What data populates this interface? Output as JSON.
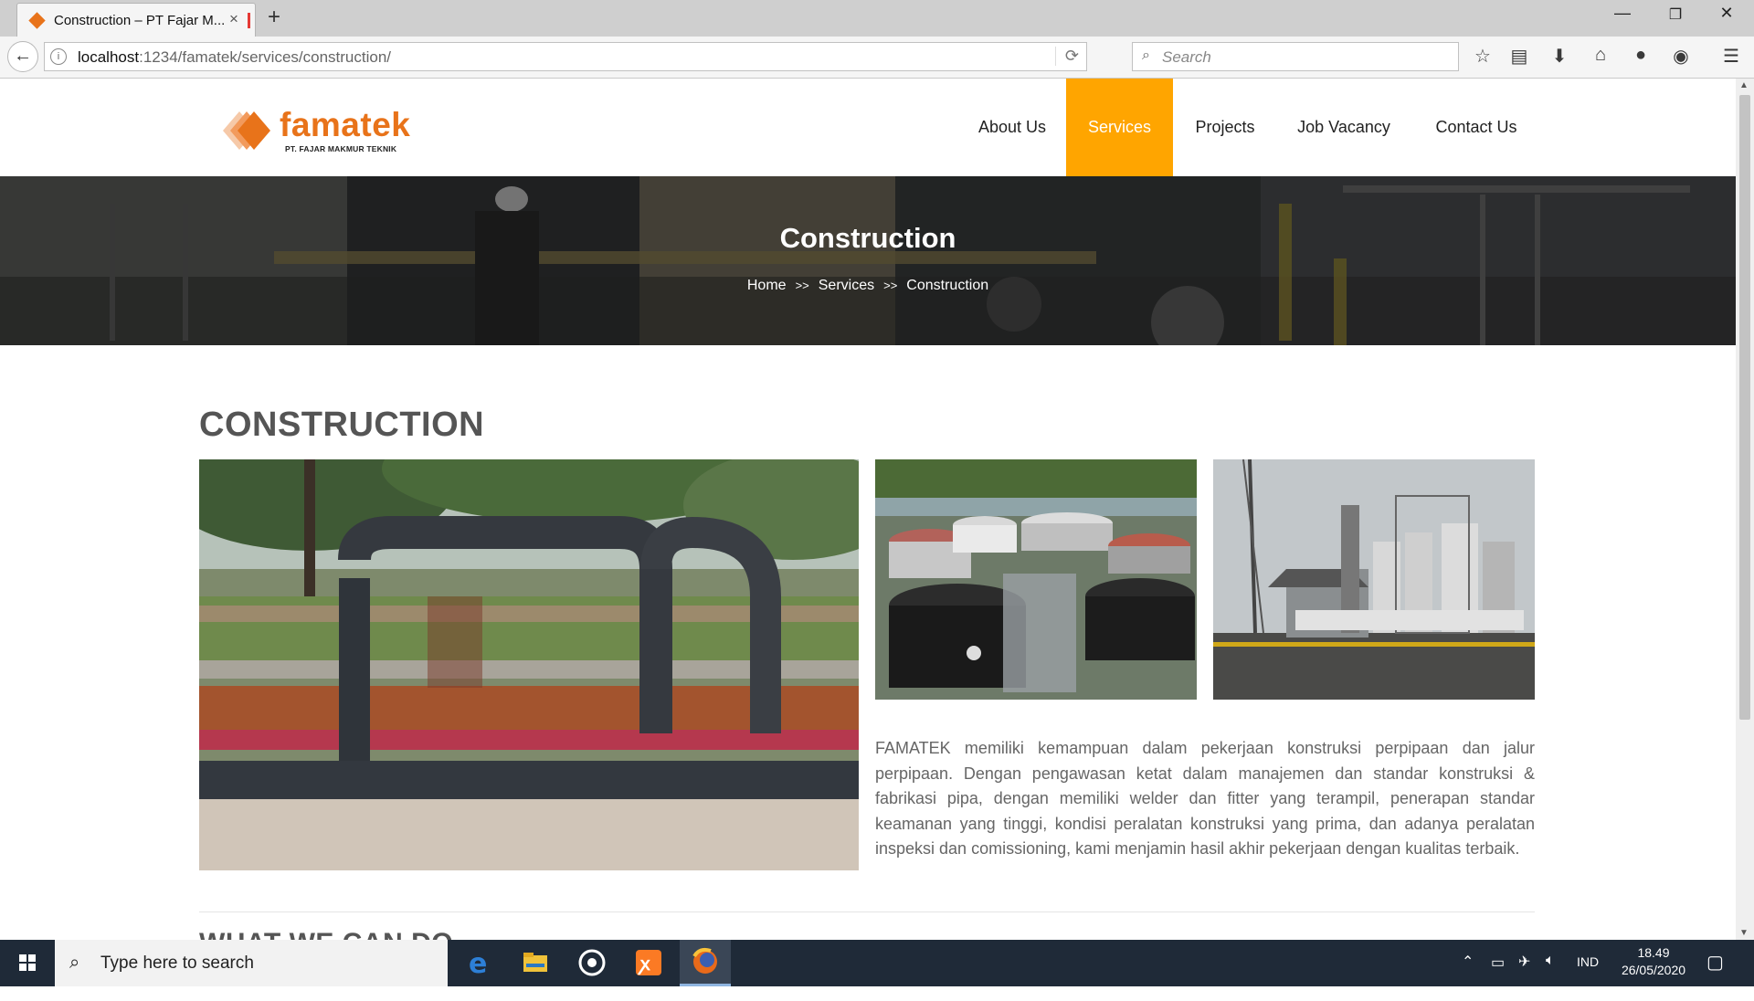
{
  "browser": {
    "tab_title": "Construction – PT Fajar M...",
    "tab_close": "×",
    "new_tab": "+",
    "url_host": "localhost",
    "url_path": ":1234/famatek/services/construction/",
    "search_placeholder": "Search",
    "window": {
      "minimize": "—",
      "restore": "❐",
      "close": "✕"
    }
  },
  "site": {
    "logo_word": "famatek",
    "logo_sub": "PT. FAJAR MAKMUR TEKNIK",
    "brand_color": "#e8731a",
    "accent_color": "#ffa500",
    "menu": [
      "About Us",
      "Services",
      "Projects",
      "Job Vacancy",
      "Contact Us"
    ],
    "menu_active": "Services"
  },
  "hero": {
    "title": "Construction",
    "breadcrumb": [
      "Home",
      "Services",
      "Construction"
    ],
    "breadcrumb_sep": ">>"
  },
  "content": {
    "section_title": "CONSTRUCTION",
    "description": "FAMATEK memiliki kemampuan dalam pekerjaan konstruksi perpipaan dan jalur perpipaan. Dengan pengawasan ketat dalam manajemen dan standar konstruksi & fabrikasi pipa, dengan memiliki welder dan fitter yang terampil, penerapan standar keamanan yang tinggi, kondisi peralatan konstruksi yang prima, dan adanya peralatan inspeksi dan comissioning, kami menjamin hasil akhir pekerjaan dengan kualitas terbaik.",
    "next_title": "WHAT WE CAN DO"
  },
  "taskbar": {
    "search_placeholder": "Type here to search",
    "language": "IND",
    "time": "18.49",
    "date": "26/05/2020"
  }
}
